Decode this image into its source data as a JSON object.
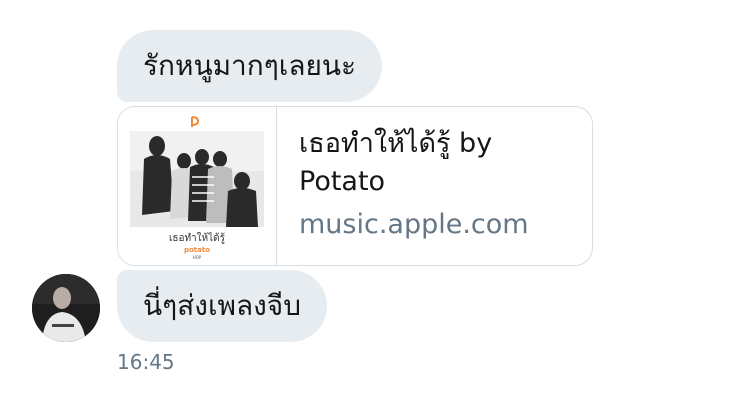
{
  "messages": {
    "first_text": "รักหนูมากๆเลยนะ",
    "second_text": "นี่ๆส่งเพลงจีบ",
    "timestamp": "16:45"
  },
  "link_card": {
    "title": "เธอทำให้ได้รู้ by Potato",
    "domain": "music.apple.com",
    "thumb_song_title": "เธอทำให้ได้รู้",
    "thumb_artist": "potato",
    "thumb_label": "HOP",
    "thumb_logo_color": "#f28a3c"
  },
  "colors": {
    "bubble_bg": "#e6ecf0",
    "secondary_text": "#657786",
    "card_border": "#d8dee2"
  }
}
